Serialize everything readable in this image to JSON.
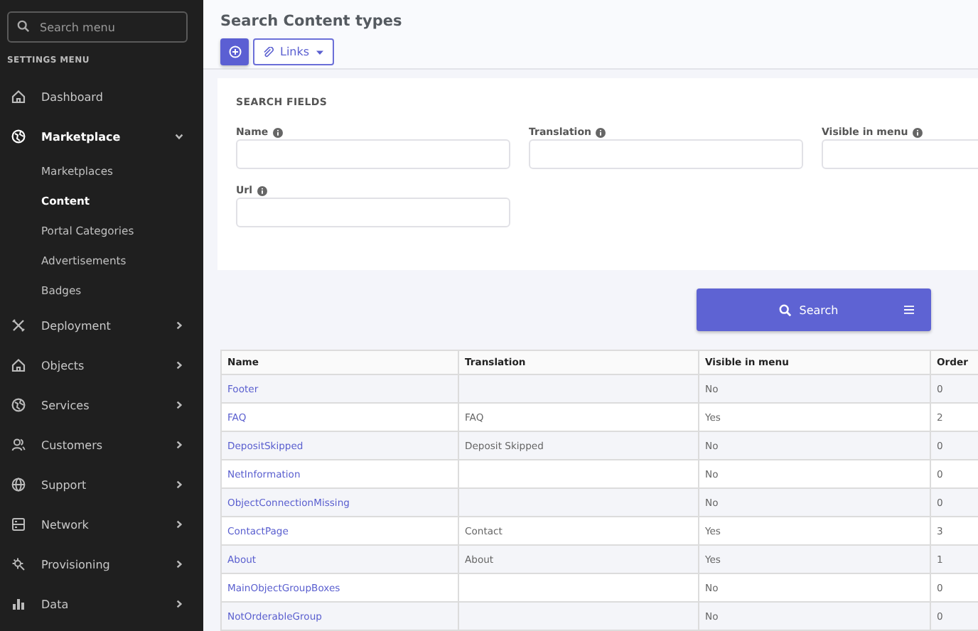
{
  "sidebar": {
    "search": {
      "placeholder": "Search menu"
    },
    "heading": "SETTINGS MENU",
    "items": [
      {
        "label": "Dashboard",
        "kind": "link"
      },
      {
        "label": "Marketplace",
        "kind": "group",
        "expanded": true,
        "children": [
          {
            "label": "Marketplaces",
            "selected": false
          },
          {
            "label": "Content",
            "selected": true
          },
          {
            "label": "Portal Categories",
            "selected": false
          },
          {
            "label": "Advertisements",
            "selected": false
          },
          {
            "label": "Badges",
            "selected": false
          }
        ]
      },
      {
        "label": "Deployment",
        "kind": "group",
        "expanded": false
      },
      {
        "label": "Objects",
        "kind": "group",
        "expanded": false
      },
      {
        "label": "Services",
        "kind": "group",
        "expanded": false
      },
      {
        "label": "Customers",
        "kind": "group",
        "expanded": false
      },
      {
        "label": "Support",
        "kind": "group",
        "expanded": false
      },
      {
        "label": "Network",
        "kind": "group",
        "expanded": false
      },
      {
        "label": "Provisioning",
        "kind": "group",
        "expanded": false
      },
      {
        "label": "Data",
        "kind": "group",
        "expanded": false
      }
    ]
  },
  "page": {
    "title": "Search Content types",
    "links_button": "Links"
  },
  "search_fields": {
    "heading": "SEARCH FIELDS",
    "fields": [
      {
        "label": "Name"
      },
      {
        "label": "Translation"
      },
      {
        "label": "Visible in menu"
      },
      {
        "label": "Url"
      }
    ],
    "button": "Search"
  },
  "table": {
    "columns": [
      "Name",
      "Translation",
      "Visible in menu",
      "Order"
    ],
    "rows": [
      [
        "Footer",
        "",
        "No",
        "0"
      ],
      [
        "FAQ",
        "FAQ",
        "Yes",
        "2"
      ],
      [
        "DepositSkipped",
        "Deposit Skipped",
        "No",
        "0"
      ],
      [
        "NetInformation",
        "",
        "No",
        "0"
      ],
      [
        "ObjectConnectionMissing",
        "",
        "No",
        "0"
      ],
      [
        "ContactPage",
        "Contact",
        "Yes",
        "3"
      ],
      [
        "About",
        "About",
        "Yes",
        "1"
      ],
      [
        "MainObjectGroupBoxes",
        "",
        "No",
        "0"
      ],
      [
        "NotOrderableGroup",
        "",
        "No",
        "0"
      ]
    ]
  }
}
